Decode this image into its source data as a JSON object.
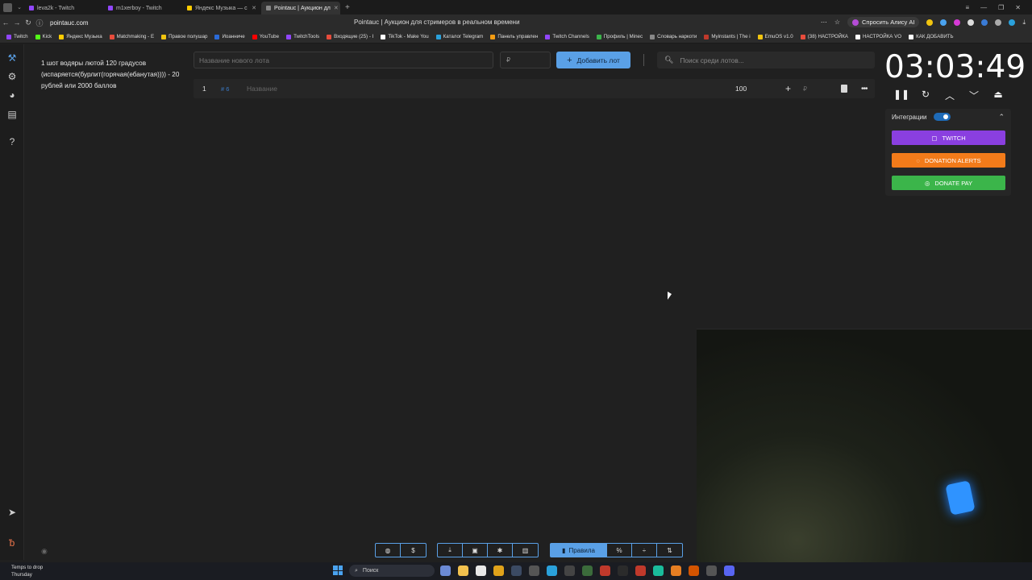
{
  "browser": {
    "tabs": [
      {
        "label": "leva2k - Twitch",
        "color": "#9146ff"
      },
      {
        "label": "m1xerboy - Twitch",
        "color": "#9146ff"
      },
      {
        "label": "Яндекс Музыка — с",
        "color": "#ffcc00"
      },
      {
        "label": "Pointauc | Аукцион дл",
        "color": "#888888",
        "active": true
      }
    ],
    "url": "pointauc.com",
    "page_title": "Pointauc | Аукцион для стримеров в реальном времени",
    "alice_label": "Спросить Алису AI",
    "bookmarks": [
      {
        "label": "Twitch",
        "color": "#9146ff"
      },
      {
        "label": "Kick",
        "color": "#53fc18"
      },
      {
        "label": "Яндекс Музыка",
        "color": "#ffcc00"
      },
      {
        "label": "Matchmaking - E",
        "color": "#e74c3c"
      },
      {
        "label": "Правое полушар",
        "color": "#f1c40f"
      },
      {
        "label": "Иоанниче",
        "color": "#2a6ad8"
      },
      {
        "label": "YouTube",
        "color": "#ff0000"
      },
      {
        "label": "TwitchTools",
        "color": "#9146ff"
      },
      {
        "label": "Входящие (25) - I",
        "color": "#e74c3c"
      },
      {
        "label": "TikTok - Make You",
        "color": "#ffffff"
      },
      {
        "label": "Каталог Telegram",
        "color": "#2aa1db"
      },
      {
        "label": "Панель управлен",
        "color": "#f39c12"
      },
      {
        "label": "Twitch Channels",
        "color": "#9146ff"
      },
      {
        "label": "Профиль | Minec",
        "color": "#3cb44b"
      },
      {
        "label": "Словарь наркоти",
        "color": "#888888"
      },
      {
        "label": "Myinstants | The i",
        "color": "#c0392b"
      },
      {
        "label": "EmuOS v1.0",
        "color": "#f1c40f"
      },
      {
        "label": "(38) НАСТРОЙКА",
        "color": "#e74c3c"
      },
      {
        "label": "НАСТРОЙКА VO",
        "color": "#ffffff"
      },
      {
        "label": "КАК ДОБАВИТЬ",
        "color": "#ffffff"
      }
    ]
  },
  "notice": "1 шот водяры лютой 120 градусов (испаряется(бурлит(горячая(ебанутая)))) - 20 рублей или 2000 баллов",
  "add_lot": {
    "name_placeholder": "Название нового лота",
    "price_placeholder": "₽",
    "button_label": "Добавить лот"
  },
  "search": {
    "placeholder": "Поиск среди лотов..."
  },
  "lots": [
    {
      "index": "1",
      "id": "# 6",
      "name_placeholder": "Название",
      "amount": "100",
      "currency": "₽"
    }
  ],
  "timer": {
    "value": "03:03:49"
  },
  "integrations": {
    "label": "Интеграции",
    "enabled": true,
    "services": [
      {
        "label": "TWITCH",
        "color": "#8a3fe0"
      },
      {
        "label": "DONATION ALERTS",
        "color": "#f27b1a"
      },
      {
        "label": "DONATE PAY",
        "color": "#3bb54a"
      }
    ]
  },
  "toolbar": {
    "rules_label": "Правила"
  },
  "taskbar": {
    "weather_line1": "Temps to drop",
    "weather_line2": "Thursday",
    "search_label": "Поиск"
  }
}
